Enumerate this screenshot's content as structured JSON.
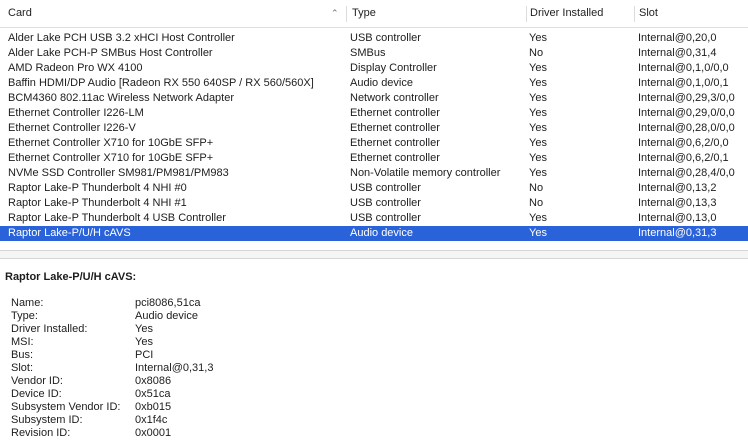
{
  "columns": {
    "card": "Card",
    "type": "Type",
    "driver": "Driver Installed",
    "slot": "Slot"
  },
  "sort_icon": "chevron-up-icon",
  "rows": [
    {
      "card": "Alder Lake PCH USB 3.2 xHCI Host Controller",
      "type": "USB controller",
      "driver": "Yes",
      "slot": "Internal@0,20,0"
    },
    {
      "card": "Alder Lake PCH-P SMBus Host Controller",
      "type": "SMBus",
      "driver": "No",
      "slot": "Internal@0,31,4"
    },
    {
      "card": "AMD Radeon Pro WX 4100",
      "type": "Display Controller",
      "driver": "Yes",
      "slot": "Internal@0,1,0/0,0"
    },
    {
      "card": "Baffin HDMI/DP Audio [Radeon RX 550 640SP / RX 560/560X]",
      "type": "Audio device",
      "driver": "Yes",
      "slot": "Internal@0,1,0/0,1"
    },
    {
      "card": "BCM4360 802.11ac Wireless Network Adapter",
      "type": "Network controller",
      "driver": "Yes",
      "slot": "Internal@0,29,3/0,0"
    },
    {
      "card": "Ethernet Controller I226-LM",
      "type": "Ethernet controller",
      "driver": "Yes",
      "slot": "Internal@0,29,0/0,0"
    },
    {
      "card": "Ethernet Controller I226-V",
      "type": "Ethernet controller",
      "driver": "Yes",
      "slot": "Internal@0,28,0/0,0"
    },
    {
      "card": "Ethernet Controller X710 for 10GbE SFP+",
      "type": "Ethernet controller",
      "driver": "Yes",
      "slot": "Internal@0,6,2/0,0"
    },
    {
      "card": "Ethernet Controller X710 for 10GbE SFP+",
      "type": "Ethernet controller",
      "driver": "Yes",
      "slot": "Internal@0,6,2/0,1"
    },
    {
      "card": "NVMe SSD Controller SM981/PM981/PM983",
      "type": "Non-Volatile memory controller",
      "driver": "Yes",
      "slot": "Internal@0,28,4/0,0"
    },
    {
      "card": "Raptor Lake-P Thunderbolt 4 NHI #0",
      "type": "USB controller",
      "driver": "No",
      "slot": "Internal@0,13,2"
    },
    {
      "card": "Raptor Lake-P Thunderbolt 4 NHI #1",
      "type": "USB controller",
      "driver": "No",
      "slot": "Internal@0,13,3"
    },
    {
      "card": "Raptor Lake-P Thunderbolt 4 USB Controller",
      "type": "USB controller",
      "driver": "Yes",
      "slot": "Internal@0,13,0"
    },
    {
      "card": "Raptor Lake-P/U/H cAVS",
      "type": "Audio device",
      "driver": "Yes",
      "slot": "Internal@0,31,3",
      "selected": true
    }
  ],
  "detail": {
    "title": "Raptor Lake-P/U/H cAVS:",
    "properties": [
      {
        "key": "Name:",
        "value": "pci8086,51ca"
      },
      {
        "key": "Type:",
        "value": "Audio device"
      },
      {
        "key": "Driver Installed:",
        "value": "Yes"
      },
      {
        "key": "MSI:",
        "value": "Yes"
      },
      {
        "key": "Bus:",
        "value": "PCI"
      },
      {
        "key": "Slot:",
        "value": "Internal@0,31,3"
      },
      {
        "key": "Vendor ID:",
        "value": "0x8086"
      },
      {
        "key": "Device ID:",
        "value": "0x51ca"
      },
      {
        "key": "Subsystem Vendor ID:",
        "value": "0xb015"
      },
      {
        "key": "Subsystem ID:",
        "value": "0x1f4c"
      },
      {
        "key": "Revision ID:",
        "value": "0x0001"
      }
    ]
  }
}
